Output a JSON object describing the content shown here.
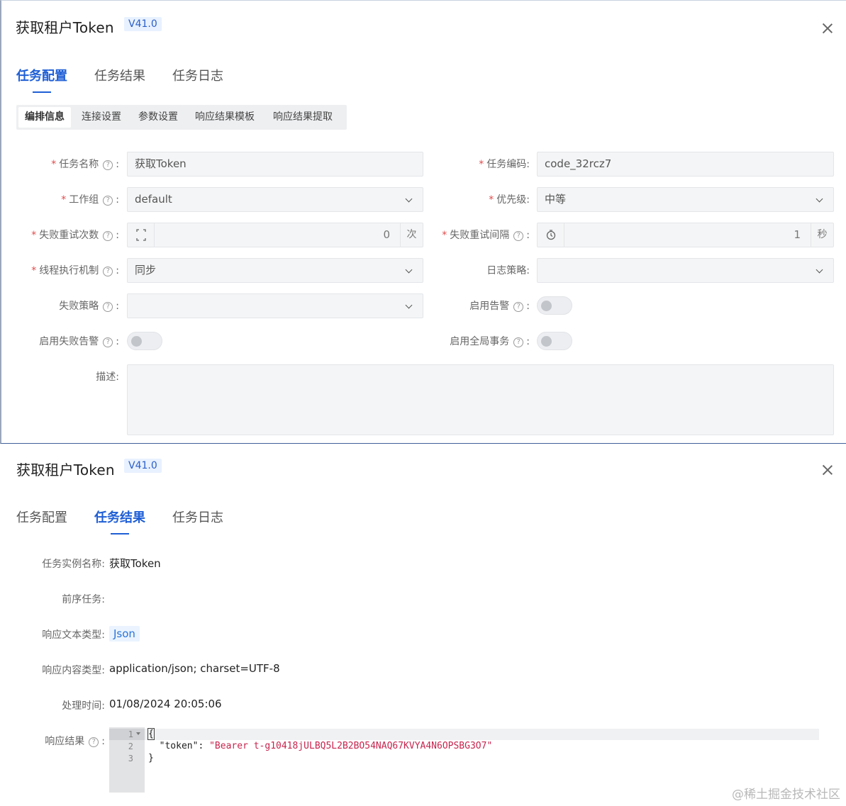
{
  "panel1": {
    "title": "获取租户Token",
    "version": "V41.0",
    "tabs": [
      "任务配置",
      "任务结果",
      "任务日志"
    ],
    "active_tab": "任务配置",
    "subtabs": [
      "编排信息",
      "连接设置",
      "参数设置",
      "响应结果模板",
      "响应结果提取"
    ],
    "active_subtab": "编排信息",
    "form": {
      "task_name": {
        "label": "任务名称",
        "required": true,
        "value": "获取Token"
      },
      "task_code": {
        "label": "任务编码",
        "required": true,
        "value": "code_32rcz7"
      },
      "work_group": {
        "label": "工作组",
        "required": true,
        "value": "default"
      },
      "priority": {
        "label": "优先级",
        "required": true,
        "value": "中等"
      },
      "retry_count": {
        "label": "失败重试次数",
        "required": true,
        "value": "0",
        "unit": "次"
      },
      "retry_interval": {
        "label": "失败重试间隔",
        "required": true,
        "value": "1",
        "unit": "秒"
      },
      "thread_mode": {
        "label": "线程执行机制",
        "required": true,
        "value": "同步"
      },
      "log_strategy": {
        "label": "日志策略",
        "required": false,
        "value": ""
      },
      "fail_strategy": {
        "label": "失败策略",
        "required": false,
        "value": ""
      },
      "enable_alert": {
        "label": "启用告警",
        "value": false
      },
      "enable_fail_alert": {
        "label": "启用失败告警",
        "value": false
      },
      "enable_global_tx": {
        "label": "启用全局事务",
        "value": false
      },
      "description": {
        "label": "描述",
        "value": ""
      }
    }
  },
  "panel2": {
    "title": "获取租户Token",
    "version": "V41.0",
    "tabs": [
      "任务配置",
      "任务结果",
      "任务日志"
    ],
    "active_tab": "任务结果",
    "result": {
      "instance_name_label": "任务实例名称",
      "instance_name": "获取Token",
      "prev_task_label": "前序任务",
      "prev_task": "",
      "resp_text_type_label": "响应文本类型",
      "resp_text_type": "Json",
      "resp_content_type_label": "响应内容类型",
      "resp_content_type": "application/json; charset=UTF-8",
      "process_time_label": "处理时间",
      "process_time": "01/08/2024 20:05:06",
      "resp_result_label": "响应结果",
      "code_line_numbers": [
        "1",
        "2",
        "3"
      ],
      "code": {
        "line1": "{",
        "key": "\"token\"",
        "sep": ": ",
        "value": "\"Bearer t-g10418jULBQ5L2B2BO54NAQ67KVYA4N6OPSBG3O7\"",
        "line3": "}"
      }
    }
  },
  "watermark": "@稀土掘金技术社区",
  "colors": {
    "accent": "#1f5fd6",
    "required": "#e24a4a",
    "json_string": "#c7254e"
  }
}
